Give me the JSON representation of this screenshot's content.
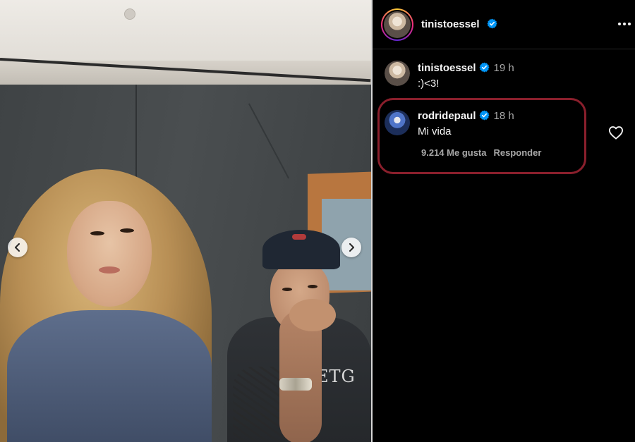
{
  "post": {
    "author": "tinistoessel",
    "author_verified": true
  },
  "photo": {
    "shirt_print": "ETG",
    "carousel": {
      "prev_icon": "chevron-left-icon",
      "next_icon": "chevron-right-icon"
    }
  },
  "header": {
    "username": "tinistoessel",
    "more_icon": "more-horizontal-icon"
  },
  "comments": [
    {
      "username": "tinistoessel",
      "verified": true,
      "time": "19 h",
      "text": ":)<3!"
    },
    {
      "username": "rodridepaul",
      "verified": true,
      "time": "18 h",
      "text": "Mi vida",
      "likes_label": "9.214 Me gusta",
      "reply_label": "Responder",
      "like_icon": "heart-outline-icon"
    }
  ],
  "colors": {
    "background": "#000000",
    "verified_badge": "#0095F6",
    "meta_text": "#A8A8A8",
    "highlight_annotation": "#8A1F2C"
  }
}
